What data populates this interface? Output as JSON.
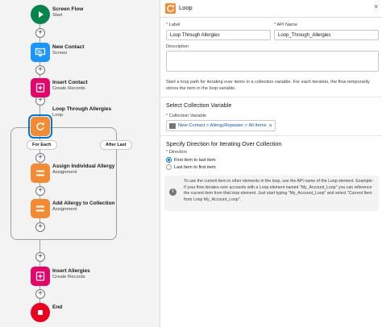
{
  "canvas": {
    "nodes": [
      {
        "title": "Screen Flow",
        "subtitle": "Start",
        "icon": "play-icon",
        "color": "#04844b"
      },
      {
        "title": "New Contact",
        "subtitle": "Screen",
        "icon": "screen-icon",
        "color": "#1b96ff"
      },
      {
        "title": "Insert Contact",
        "subtitle": "Create Records",
        "icon": "create-records-icon",
        "color": "#e3066a"
      },
      {
        "title": "Loop Through Allergies",
        "subtitle": "Loop",
        "icon": "loop-icon",
        "color": "#f38b34"
      },
      {
        "title": "Assign Individual Allergy",
        "subtitle": "Assignment",
        "icon": "assignment-icon",
        "color": "#f38b34"
      },
      {
        "title": "Add Allergy to Collection",
        "subtitle": "Assignment",
        "icon": "assignment-icon",
        "color": "#f38b34"
      },
      {
        "title": "Insert Allergies",
        "subtitle": "Create Records",
        "icon": "create-records-icon",
        "color": "#e3066a"
      },
      {
        "title": "End",
        "subtitle": "",
        "icon": "stop-icon",
        "color": "#ea001e"
      }
    ],
    "for_each_label": "For Each",
    "after_last_label": "After Last"
  },
  "panel": {
    "title": "Loop",
    "close_glyph": "×",
    "label_field": {
      "label": "Label",
      "value": "Loop Through Allergies"
    },
    "api_field": {
      "label": "API Name",
      "value": "Loop_Through_Allergies"
    },
    "description_label": "Description",
    "description_value": "",
    "intro_text": "Start a loop path for iterating over items in a collection variable. For each iteration, the flow temporarily stores the item in the loop variable.",
    "collection_section": "Select Collection Variable",
    "collection_label": "Collection Variable",
    "collection_value": "New Contact > AllergyRepeater > All Items",
    "direction_section": "Specify Direction for Iterating Over Collection",
    "direction_label": "Direction",
    "direction_options": [
      {
        "label": "First item to last item",
        "selected": true
      },
      {
        "label": "Last item to first item",
        "selected": false
      }
    ],
    "info_text": "To use the current item in other elements in the loop, use the API name of the Loop element. Example: If your flow iterates over accounts with a Loop element named \"My_Account_Loop\" you can reference the current item from that loop element. Just start typing \"My_Account_Loop\" and select \"Current Item from Loop My_Account_Loop\"."
  }
}
